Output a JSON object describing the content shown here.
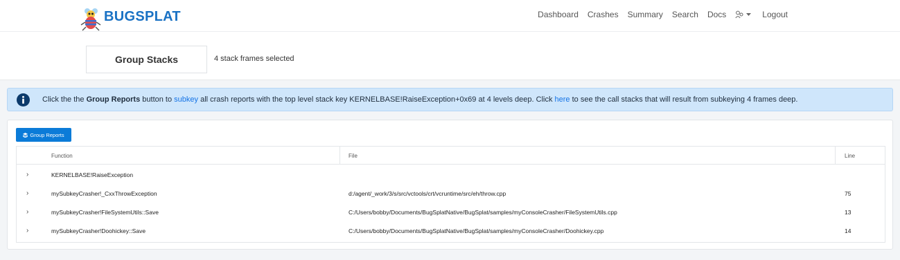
{
  "brand": {
    "name": "BUGSPLAT"
  },
  "nav": {
    "dashboard": "Dashboard",
    "crashes": "Crashes",
    "summary": "Summary",
    "search": "Search",
    "docs": "Docs",
    "logout": "Logout"
  },
  "page": {
    "title": "Group Stacks",
    "selected_text": "4 stack frames selected"
  },
  "alert": {
    "part1": "Click the the ",
    "bold1": "Group Reports",
    "part2": " button to ",
    "link1": "subkey",
    "part3": " all crash reports with the top level stack key KERNELBASE!RaiseException+0x69 at 4 levels deep. Click ",
    "link2": "here",
    "part4": " to see the call stacks that will result from subkeying 4 frames deep."
  },
  "actions": {
    "group_reports": "Group Reports"
  },
  "table": {
    "headers": {
      "function": "Function",
      "file": "File",
      "line": "Line"
    },
    "rows": [
      {
        "expander": "›",
        "function": "KERNELBASE!RaiseException",
        "file": "",
        "line": ""
      },
      {
        "expander": "›",
        "function": "mySubkeyCrasher!_CxxThrowException",
        "file": "d:/agent/_work/3/s/src/vctools/crt/vcruntime/src/eh/throw.cpp",
        "line": "75"
      },
      {
        "expander": "›",
        "function": "mySubkeyCrasher!FileSystemUtils::Save",
        "file": "C:/Users/bobby/Documents/BugSplatNative/BugSplat/samples/myConsoleCrasher/FileSystemUtils.cpp",
        "line": "13"
      },
      {
        "expander": "›",
        "function": "mySubkeyCrasher!Doohickey::Save",
        "file": "C:/Users/bobby/Documents/BugSplatNative/BugSplat/samples/myConsoleCrasher/Doohickey.cpp",
        "line": "14"
      }
    ]
  },
  "colors": {
    "brand_blue": "#1a72c4",
    "button_blue": "#0b7bd8",
    "alert_bg": "#cfe6fb",
    "link": "#1473e6"
  },
  "icons": [
    "bug-logo-icon",
    "users-icon",
    "caret-down-icon",
    "info-circle-icon",
    "layers-icon",
    "chevron-right-icon"
  ]
}
